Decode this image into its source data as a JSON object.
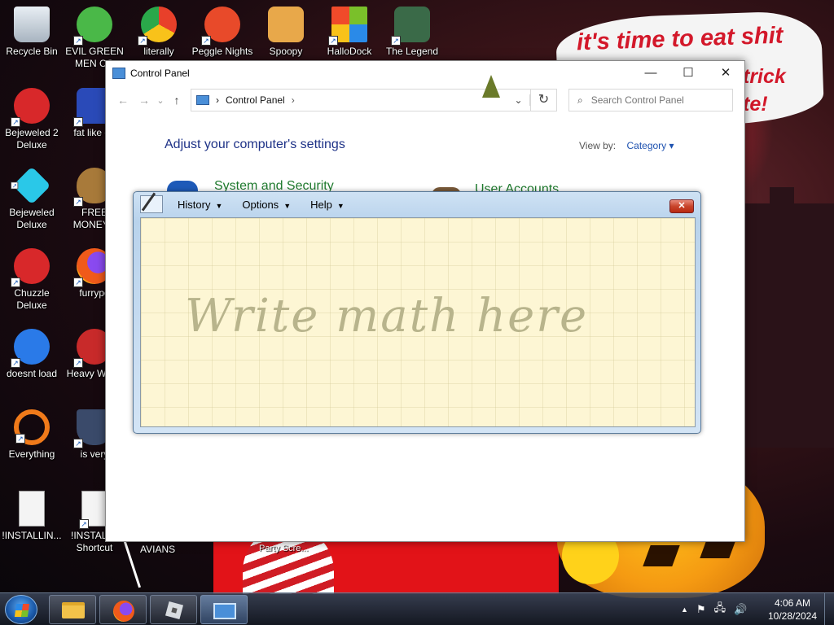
{
  "wallpaper": {
    "sign_line1": "it's time to eat shit",
    "sign_line2": "trick",
    "sign_line3": "te!",
    "party_label": "Party Scre...",
    "avians_label": "AVIANS"
  },
  "desktop_icons": [
    {
      "label": "Recycle Bin",
      "color": "#c8d0d8"
    },
    {
      "label": "EVIL GREEN MEN CO",
      "color": "#4ab848"
    },
    {
      "label": "literally",
      "color": "#4a8ae8"
    },
    {
      "label": "Peggle Nights",
      "color": "#e84a2a"
    },
    {
      "label": "Spoopy",
      "color": "#e8a84a"
    },
    {
      "label": "HalloDock",
      "color": "#f05a2a"
    },
    {
      "label": "The Legend",
      "color": "#3a6a48"
    },
    {
      "label": "Bejeweled 2 Deluxe",
      "color": "#d8282a"
    },
    {
      "label": "fat like da",
      "color": "#2a4ab8"
    },
    {
      "label": "Bejeweled Deluxe",
      "color": "#2ac8e8"
    },
    {
      "label": "FREE MONEY.e",
      "color": "#a87a3a"
    },
    {
      "label": "Chuzzle Deluxe",
      "color": "#d8282a"
    },
    {
      "label": "furrypo",
      "color": "#f07a1a"
    },
    {
      "label": "doesnt load",
      "color": "#2a7ae8"
    },
    {
      "label": "Heavy Weap",
      "color": "#c82a2a"
    },
    {
      "label": "Everything",
      "color": "#f07a1a"
    },
    {
      "label": "is very",
      "color": "#3a4a6a"
    },
    {
      "label": "!INSTALLIN...",
      "color": "#f4f4f4"
    },
    {
      "label": "!INSTALL - Shortcut",
      "color": "#f4f4f4"
    }
  ],
  "control_panel": {
    "title": "Control Panel",
    "caption_minimize": "—",
    "caption_maximize": "☐",
    "caption_close": "✕",
    "nav_back": "←",
    "nav_forward": "→",
    "nav_recent": "⌄",
    "nav_up": "↑",
    "breadcrumb_sep": "›",
    "breadcrumb": "Control Panel",
    "breadcrumb_tail": "›",
    "address_dropdown": "⌄",
    "refresh": "↻",
    "search_icon": "⌕",
    "search_placeholder": "Search Control Panel",
    "heading": "Adjust your computer's settings",
    "view_by_label": "View by:",
    "view_by_value": "Category ▾",
    "categories": [
      "System and Security",
      "User Accounts"
    ]
  },
  "math_input": {
    "menus": [
      {
        "label": "History",
        "caret": "▼"
      },
      {
        "label": "Options",
        "caret": "▼"
      },
      {
        "label": "Help",
        "caret": "▼"
      }
    ],
    "close": "✕",
    "placeholder": "Write math here"
  },
  "taskbar": {
    "clock_time": "4:06 AM",
    "clock_date": "10/28/2024",
    "tray_icons": [
      "▲",
      "⚑",
      "🖧",
      "🔊"
    ]
  }
}
